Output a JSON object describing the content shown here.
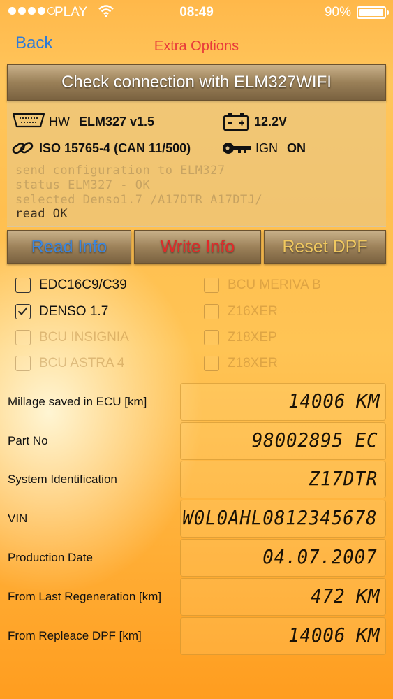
{
  "status_bar": {
    "carrier": "PLAY",
    "time": "08:49",
    "battery": "90%",
    "battery_level": 0.9
  },
  "nav": {
    "back_label": "Back",
    "title": "Extra Options"
  },
  "check_button": "Check connection with ELM327WIFI",
  "info": {
    "hw_prefix": "HW",
    "hw_value": "ELM327 v1.5",
    "voltage": "12.2V",
    "protocol": "ISO 15765-4 (CAN 11/500)",
    "ign_prefix": "IGN",
    "ign_value": "ON",
    "log": [
      "send configuration to ELM327",
      "status ELM327 - OK",
      "selected Denso1.7 /A17DTR A17DTJ/",
      "read OK"
    ]
  },
  "actions": {
    "read": "Read Info",
    "write": "Write Info",
    "reset": "Reset DPF"
  },
  "ecu_options": [
    {
      "label": "EDC16C9/C39",
      "checked": false,
      "enabled": true
    },
    {
      "label": "BCU MERIVA B",
      "checked": false,
      "enabled": false
    },
    {
      "label": "DENSO 1.7",
      "checked": true,
      "enabled": true
    },
    {
      "label": "Z16XER",
      "checked": false,
      "enabled": false
    },
    {
      "label": "BCU INSIGNIA",
      "checked": false,
      "enabled": false
    },
    {
      "label": "Z18XEP",
      "checked": false,
      "enabled": false
    },
    {
      "label": "BCU ASTRA 4",
      "checked": false,
      "enabled": false
    },
    {
      "label": "Z18XER",
      "checked": false,
      "enabled": false
    }
  ],
  "fields": [
    {
      "label": "Millage saved in ECU [km]",
      "value": "14006",
      "unit": "KM"
    },
    {
      "label": "Part No",
      "value": "98002895 EC",
      "unit": ""
    },
    {
      "label": "System Identification",
      "value": "Z17DTR",
      "unit": ""
    },
    {
      "label": "VIN",
      "value": "W0L0AHL0812345678",
      "unit": ""
    },
    {
      "label": "Production Date",
      "value": "04.07.2007",
      "unit": ""
    },
    {
      "label": "From Last Regeneration [km]",
      "value": "472",
      "unit": "KM"
    },
    {
      "label": "From Repleace DPF [km]",
      "value": "14006",
      "unit": "KM"
    }
  ],
  "colors": {
    "back": "#2e7bd8",
    "title": "#e83a3a",
    "read": "#2e7bd8",
    "write": "#e02a2a",
    "reset": "#f0c860"
  }
}
